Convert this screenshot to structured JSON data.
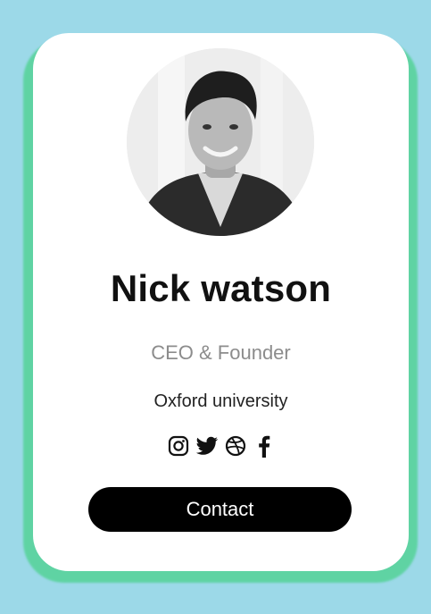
{
  "profile": {
    "name": "Nick watson",
    "role": "CEO & Founder",
    "organization": "Oxford university"
  },
  "socials": [
    {
      "icon": "instagram-icon"
    },
    {
      "icon": "twitter-icon"
    },
    {
      "icon": "dribbble-icon"
    },
    {
      "icon": "facebook-icon"
    }
  ],
  "contact_button": {
    "label": "Contact"
  },
  "colors": {
    "background": "#9cd9e8",
    "card_border": "#5fd3a3",
    "card": "#ffffff",
    "button": "#000000",
    "role_text": "#8c8c8c"
  }
}
